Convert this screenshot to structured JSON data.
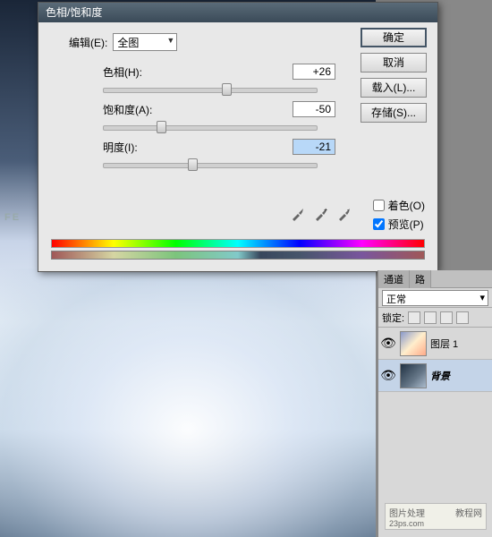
{
  "dialog": {
    "title": "色相/饱和度",
    "edit_label": "编辑(E):",
    "edit_value": "全图",
    "hue_label": "色相(H):",
    "hue_value": "+26",
    "sat_label": "饱和度(A):",
    "sat_value": "-50",
    "light_label": "明度(I):",
    "light_value": "-21",
    "btn_ok": "确定",
    "btn_cancel": "取消",
    "btn_load": "载入(L)...",
    "btn_save": "存储(S)...",
    "colorize_label": "着色(O)",
    "preview_label": "预览(P)"
  },
  "panel": {
    "tab_channels": "通道",
    "tab_paths": "路",
    "blend_mode": "正常",
    "lock_label": "锁定:",
    "layer1_name": "图层 1",
    "bg_name": "背景"
  },
  "bg_text": "FE",
  "watermark": {
    "line1": "图片处理",
    "line2": "23ps.com",
    "line3": "教程网"
  }
}
